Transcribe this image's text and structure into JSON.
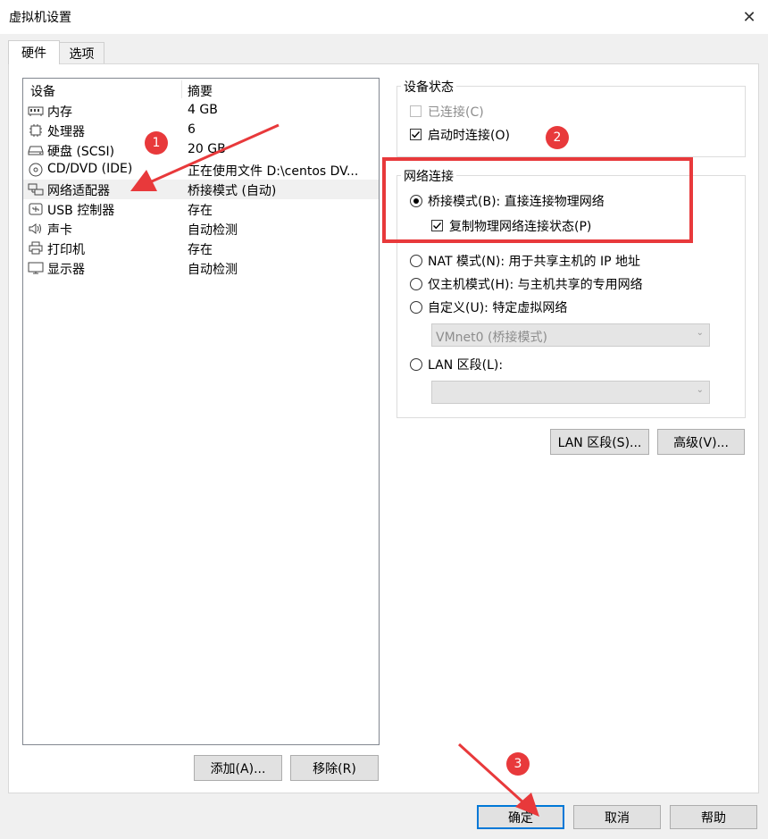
{
  "window": {
    "title": "虚拟机设置",
    "close_glyph": "✕"
  },
  "tabs": [
    {
      "label": "硬件",
      "active": true
    },
    {
      "label": "选项",
      "active": false
    }
  ],
  "device_list": {
    "columns": [
      "设备",
      "摘要"
    ],
    "rows": [
      {
        "name": "内存",
        "summary": "4 GB",
        "icon": "memory-icon"
      },
      {
        "name": "处理器",
        "summary": "6",
        "icon": "cpu-icon"
      },
      {
        "name": "硬盘 (SCSI)",
        "summary": "20 GB",
        "icon": "harddisk-icon"
      },
      {
        "name": "CD/DVD (IDE)",
        "summary": "正在使用文件 D:\\centos DV...",
        "icon": "cdrom-icon"
      },
      {
        "name": "网络适配器",
        "summary": "桥接模式 (自动)",
        "icon": "network-adapter-icon",
        "selected": true
      },
      {
        "name": "USB 控制器",
        "summary": "存在",
        "icon": "usb-icon"
      },
      {
        "name": "声卡",
        "summary": "自动检测",
        "icon": "speaker-icon"
      },
      {
        "name": "打印机",
        "summary": "存在",
        "icon": "printer-icon"
      },
      {
        "name": "显示器",
        "summary": "自动检测",
        "icon": "monitor-icon"
      }
    ]
  },
  "list_buttons": {
    "add": "添加(A)...",
    "remove": "移除(R)"
  },
  "device_status": {
    "title": "设备状态",
    "connected": {
      "label": "已连接(C)",
      "checked": false,
      "disabled": true
    },
    "connect_at_power_on": {
      "label": "启动时连接(O)",
      "checked": true
    }
  },
  "network_connection": {
    "title": "网络连接",
    "bridged": {
      "label": "桥接模式(B): 直接连接物理网络",
      "selected": true
    },
    "replicate": {
      "label": "复制物理网络连接状态(P)",
      "checked": true
    },
    "nat": {
      "label": "NAT 模式(N): 用于共享主机的 IP 地址",
      "selected": false
    },
    "host_only": {
      "label": "仅主机模式(H): 与主机共享的专用网络",
      "selected": false
    },
    "custom": {
      "label": "自定义(U): 特定虚拟网络",
      "selected": false
    },
    "custom_select": {
      "value": "VMnet0 (桥接模式)"
    },
    "lan_segment": {
      "label": "LAN 区段(L):",
      "selected": false
    },
    "lan_select": {
      "value": ""
    }
  },
  "adapter_buttons": {
    "lan_segments": "LAN 区段(S)...",
    "advanced": "高级(V)..."
  },
  "footer_buttons": {
    "ok": "确定",
    "cancel": "取消",
    "help": "帮助"
  },
  "annotations": {
    "badges": [
      "1",
      "2",
      "3"
    ],
    "color": "#e8393b"
  },
  "colors": {
    "accent": "#0078d7",
    "annotation_red": "#e8393b"
  }
}
